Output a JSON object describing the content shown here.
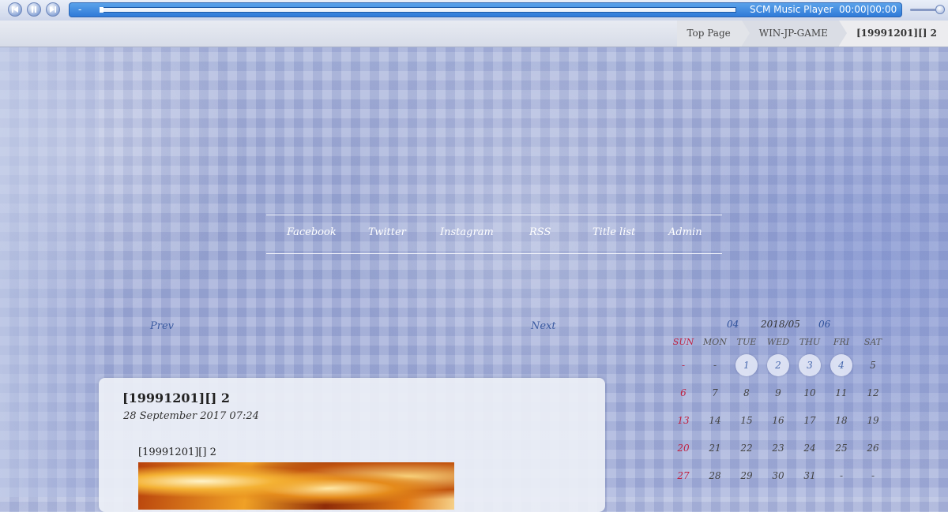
{
  "player": {
    "dash": "-",
    "title": "SCM Music Player",
    "time": "00:00|00:00",
    "controls": [
      "prev-track-icon",
      "pause-icon",
      "next-track-icon"
    ]
  },
  "breadcrumb": [
    "Top Page",
    "WIN-JP-GAME",
    "[19991201][] 2"
  ],
  "nav": [
    "Facebook",
    "Twitter",
    "Instagram",
    "RSS",
    "Title list",
    "Admin"
  ],
  "pager": {
    "prev": "Prev",
    "next": "Next"
  },
  "article": {
    "title": "[19991201][] 2",
    "date": "28 September 2017 07:24",
    "body_title": "[19991201][] 2"
  },
  "calendar": {
    "prev": "04",
    "current": "2018/05",
    "next": "06",
    "weekdays": [
      "SUN",
      "MON",
      "TUE",
      "WED",
      "THU",
      "FRI",
      "SAT"
    ],
    "weeks": [
      [
        "-",
        "-",
        "1",
        "2",
        "3",
        "4",
        "5"
      ],
      [
        "6",
        "7",
        "8",
        "9",
        "10",
        "11",
        "12"
      ],
      [
        "13",
        "14",
        "15",
        "16",
        "17",
        "18",
        "19"
      ],
      [
        "20",
        "21",
        "22",
        "23",
        "24",
        "25",
        "26"
      ],
      [
        "27",
        "28",
        "29",
        "30",
        "31",
        "-",
        "-"
      ]
    ],
    "highlighted": [
      "1",
      "2",
      "3",
      "4"
    ],
    "colors": {
      "sunday": "#c02040",
      "link": "#2c4f9a"
    }
  }
}
